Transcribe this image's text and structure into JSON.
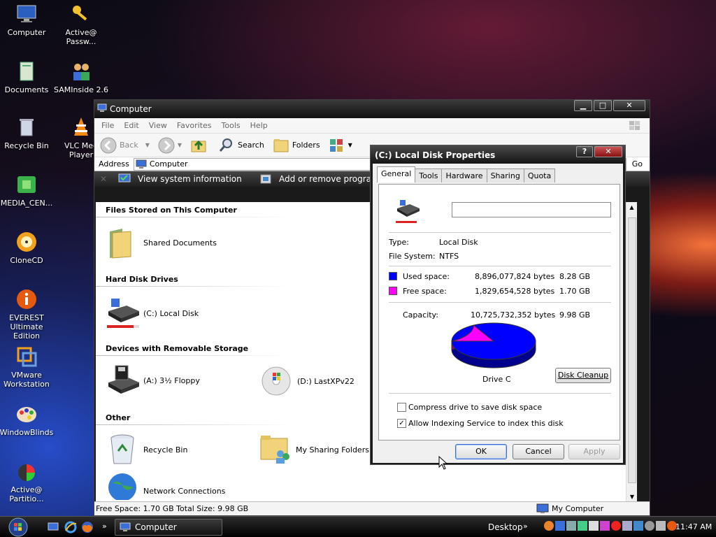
{
  "desktop_icons": [
    {
      "label": "Computer"
    },
    {
      "label": "Active@ Passw..."
    },
    {
      "label": "Documents"
    },
    {
      "label": "SAMInside 2.6"
    },
    {
      "label": "Recycle Bin"
    },
    {
      "label": "VLC Med Player"
    },
    {
      "label": "MEDIA_CEN..."
    },
    {
      "label": "CloneCD"
    },
    {
      "label": "EVEREST Ultimate Edition"
    },
    {
      "label": "VMware Workstation"
    },
    {
      "label": "WindowBlinds"
    },
    {
      "label": "Active@ Partitio..."
    }
  ],
  "explorer": {
    "title": "Computer",
    "menu": [
      "File",
      "Edit",
      "View",
      "Favorites",
      "Tools",
      "Help"
    ],
    "toolbar": {
      "back": "Back",
      "search": "Search",
      "folders": "Folders"
    },
    "address_label": "Address",
    "address_value": "Computer",
    "go": "Go",
    "tasks": [
      "View system information",
      "Add or remove programs"
    ],
    "groups": {
      "files": "Files Stored on This Computer",
      "hdd": "Hard Disk Drives",
      "removable": "Devices with Removable Storage",
      "other": "Other"
    },
    "items": {
      "shared_docs": "Shared Documents",
      "local_disk": "(C:) Local Disk",
      "floppy": "(A:) 3½ Floppy",
      "dvd": "(D:) LastXPv22",
      "recycle": "Recycle Bin",
      "sharing": "My Sharing Folders",
      "network": "Network Connections"
    },
    "status": {
      "left": "Free Space: 1.70 GB Total Size: 9.98 GB",
      "right": "My Computer"
    }
  },
  "dialog": {
    "title": "(C:) Local Disk Properties",
    "tabs": [
      "General",
      "Tools",
      "Hardware",
      "Sharing",
      "Quota"
    ],
    "name_value": "",
    "type_label": "Type:",
    "type_value": "Local Disk",
    "fs_label": "File System:",
    "fs_value": "NTFS",
    "used_label": "Used space:",
    "used_bytes": "8,896,077,824 bytes",
    "used_gb": "8.28 GB",
    "free_label": "Free space:",
    "free_bytes": "1,829,654,528 bytes",
    "free_gb": "1.70 GB",
    "cap_label": "Capacity:",
    "cap_bytes": "10,725,732,352 bytes",
    "cap_gb": "9.98 GB",
    "drive_label": "Drive C",
    "cleanup": "Disk Cleanup",
    "compress": "Compress drive to save disk space",
    "compress_checked": false,
    "indexing": "Allow Indexing Service to index this disk",
    "indexing_checked": true,
    "ok": "OK",
    "cancel": "Cancel",
    "apply": "Apply",
    "used_fraction": 0.829,
    "colors": {
      "used": "#0000ff",
      "free": "#ff00ff"
    }
  },
  "taskbar": {
    "task": "Computer",
    "desktop": "Desktop",
    "time": "11:47 AM"
  }
}
